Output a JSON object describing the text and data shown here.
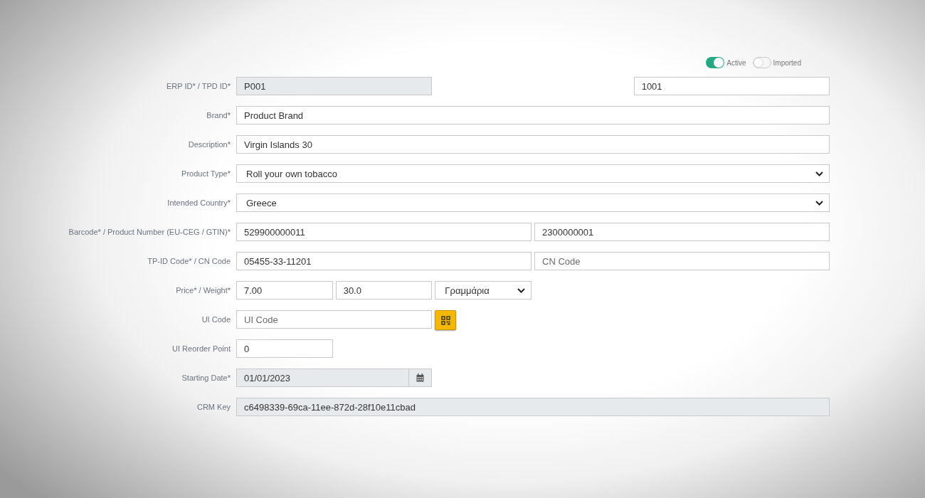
{
  "toggles": [
    {
      "label": "Active",
      "on": true
    },
    {
      "label": "Imported",
      "on": false
    }
  ],
  "rows": [
    {
      "label": "ERP ID* / TPD ID*",
      "controls": [
        {
          "kind": "input",
          "value": "P001",
          "disabled": true
        },
        {
          "kind": "input",
          "value": "1001",
          "disabled": false
        }
      ]
    },
    {
      "label": "Brand*",
      "controls": [
        {
          "kind": "input",
          "value": "Product Brand",
          "disabled": false
        }
      ]
    },
    {
      "label": "Description*",
      "controls": [
        {
          "kind": "input",
          "value": "Virgin Islands 30",
          "disabled": false
        }
      ]
    },
    {
      "label": "Product Type*",
      "controls": [
        {
          "kind": "select",
          "value": "Roll your own tobacco"
        }
      ]
    },
    {
      "label": "Intended Country*",
      "controls": [
        {
          "kind": "select",
          "value": "Greece"
        }
      ]
    },
    {
      "label": "Barcode* / Product Number (EU-CEG / GTIN)*",
      "controls": [
        {
          "kind": "input",
          "value": "529900000011",
          "disabled": false
        },
        {
          "kind": "input",
          "value": "2300000001",
          "disabled": false
        }
      ]
    },
    {
      "label": "TP-ID Code* / CN Code",
      "controls": [
        {
          "kind": "input",
          "value": "05455-33-11201",
          "disabled": false
        },
        {
          "kind": "input",
          "placeholder": "CN Code",
          "disabled": false
        }
      ]
    },
    {
      "label": "Price* / Weight*",
      "controls": [
        {
          "kind": "input",
          "value": "7.00",
          "disabled": false
        },
        {
          "kind": "input",
          "value": "30.0",
          "disabled": false
        },
        {
          "kind": "select",
          "value": "Γραμμάρια"
        }
      ]
    },
    {
      "label": "UI Code",
      "controls": [
        {
          "kind": "input",
          "placeholder": "UI Code",
          "disabled": false
        },
        {
          "kind": "qr-button"
        }
      ]
    },
    {
      "label": "UI Reorder Point",
      "controls": [
        {
          "kind": "input",
          "value": "0",
          "disabled": false
        }
      ]
    },
    {
      "label": "Starting Date*",
      "controls": [
        {
          "kind": "date",
          "value": "01/01/2023",
          "disabled": true
        }
      ]
    },
    {
      "label": "CRM Key",
      "controls": [
        {
          "kind": "input",
          "value": "c6498339-69ca-11ee-872d-28f10e11cbad",
          "disabled": true
        }
      ]
    }
  ]
}
